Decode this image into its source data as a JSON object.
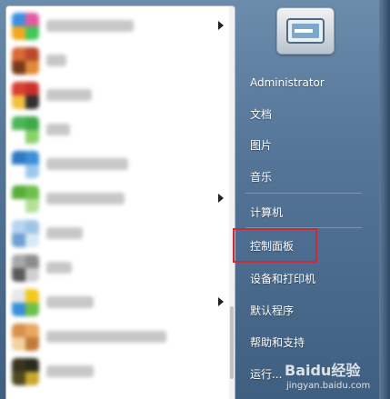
{
  "program_list": {
    "items": [
      {
        "icon": "blurred-app-icon",
        "colors": [
          "#e45aa0",
          "#40c85a",
          "#f2a81e",
          "#3d8fe3"
        ],
        "label_width": 96,
        "has_submenu": true
      },
      {
        "icon": "blurred-app-icon",
        "colors": [
          "#b94a2a",
          "#e08a3a",
          "#7a3a1a",
          "#d86a34"
        ],
        "label_width": 22,
        "has_submenu": false
      },
      {
        "icon": "blurred-app-icon",
        "colors": [
          "#c8302a",
          "#303030",
          "#f0c040",
          "#d94030"
        ],
        "label_width": 50,
        "has_submenu": false
      },
      {
        "icon": "blurred-app-icon",
        "colors": [
          "#3da84a",
          "#8ad16a",
          "#ffffff",
          "#4cb65a"
        ],
        "label_width": 26,
        "has_submenu": false
      },
      {
        "icon": "blurred-app-icon",
        "colors": [
          "#3a8fd8",
          "#9cc8ee",
          "#ffffff",
          "#2f78c4"
        ],
        "label_width": 90,
        "has_submenu": false
      },
      {
        "icon": "blurred-app-icon",
        "colors": [
          "#6cbf4a",
          "#b6e09a",
          "#ffffff",
          "#58ad38"
        ],
        "label_width": 86,
        "has_submenu": true
      },
      {
        "icon": "blurred-app-icon",
        "colors": [
          "#9fc4e8",
          "#d8e8f6",
          "#6fa0d0",
          "#b8d4ee"
        ],
        "label_width": 40,
        "has_submenu": false
      },
      {
        "icon": "blurred-app-icon",
        "colors": [
          "#8c8c8c",
          "#d0d0d0",
          "#5a5a5a",
          "#a8a8a8"
        ],
        "label_width": 28,
        "has_submenu": false
      },
      {
        "icon": "blurred-app-icon",
        "colors": [
          "#f2c81e",
          "#6cc04a",
          "#3a8fd8",
          "#e8e8e8"
        ],
        "label_width": 52,
        "has_submenu": true
      },
      {
        "icon": "blurred-app-icon",
        "colors": [
          "#e8a860",
          "#c07a3a",
          "#f4d0a0",
          "#d8904a"
        ],
        "label_width": 132,
        "has_submenu": false
      },
      {
        "icon": "blurred-app-icon",
        "colors": [
          "#2a2a1a",
          "#c8a830",
          "#504a20",
          "#383420"
        ],
        "label_width": 52,
        "has_submenu": false
      }
    ]
  },
  "right_pane": {
    "user_name": "Administrator",
    "documents": "文档",
    "pictures": "图片",
    "music": "音乐",
    "computer": "计算机",
    "control_panel": "控制面板",
    "devices_printers": "设备和打印机",
    "default_programs": "默认程序",
    "help_support": "帮助和支持",
    "run": "运行..."
  },
  "annotation": {
    "highlight_color": "#d0283b"
  },
  "watermark": {
    "main": "Baidu经验",
    "sub": "jingyan.baidu.com"
  }
}
